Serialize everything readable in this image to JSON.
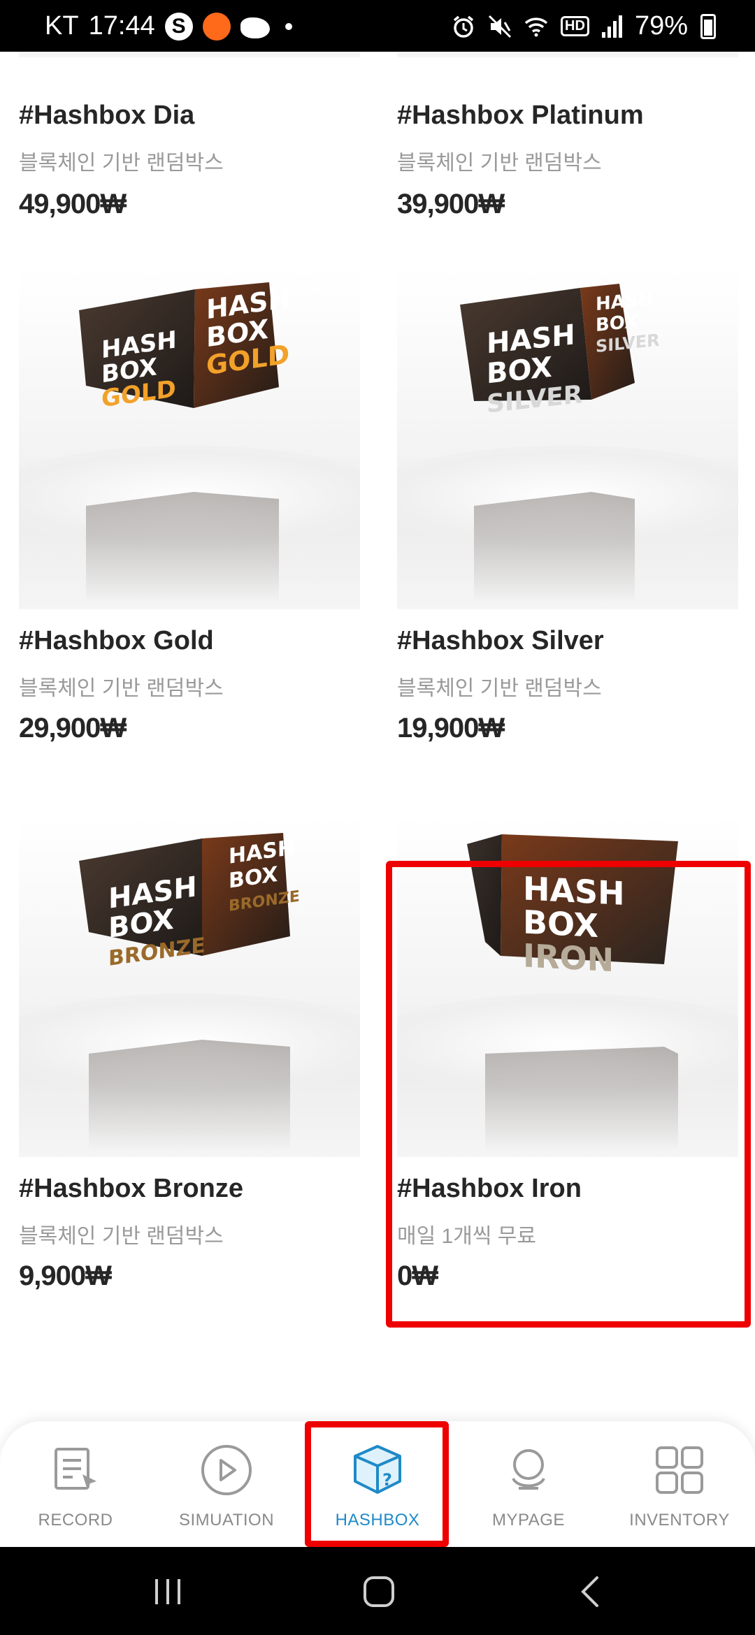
{
  "status_bar": {
    "carrier": "KT",
    "time": "17:44",
    "battery": "79%"
  },
  "products": [
    {
      "name": "#Hashbox Dia",
      "desc": "블록체인 기반 랜덤박스",
      "price": "49,900₩"
    },
    {
      "name": "#Hashbox Platinum",
      "desc": "블록체인 기반 랜덤박스",
      "price": "39,900₩"
    },
    {
      "name": "#Hashbox Gold",
      "desc": "블록체인 기반 랜덤박스",
      "price": "29,900₩",
      "box_lines": [
        "HASH",
        "BOX",
        "GOLD"
      ],
      "accent": "#f2a12a"
    },
    {
      "name": "#Hashbox Silver",
      "desc": "블록체인 기반 랜덤박스",
      "price": "19,900₩",
      "box_lines": [
        "HASH",
        "BOX",
        "SILVER"
      ],
      "accent": "#d8d8d8"
    },
    {
      "name": "#Hashbox Bronze",
      "desc": "블록체인 기반 랜덤박스",
      "price": "9,900₩",
      "box_lines": [
        "HASH",
        "BOX",
        "BRONZE"
      ],
      "accent": "#9a6a2a"
    },
    {
      "name": "#Hashbox Iron",
      "desc": "매일 1개씩 무료",
      "price": "0₩",
      "box_lines": [
        "HASH",
        "BOX",
        "IRON"
      ],
      "accent": "#b5ab98"
    }
  ],
  "bottom_nav": [
    {
      "label": "RECORD",
      "icon": "record-icon"
    },
    {
      "label": "SIMUATION",
      "icon": "play-icon"
    },
    {
      "label": "HASHBOX",
      "icon": "hashbox-icon",
      "active": true
    },
    {
      "label": "MYPAGE",
      "icon": "user-icon"
    },
    {
      "label": "INVENTORY",
      "icon": "grid-icon"
    }
  ],
  "colors": {
    "highlight": "#ee0000",
    "active_tab": "#1f8ac8"
  }
}
